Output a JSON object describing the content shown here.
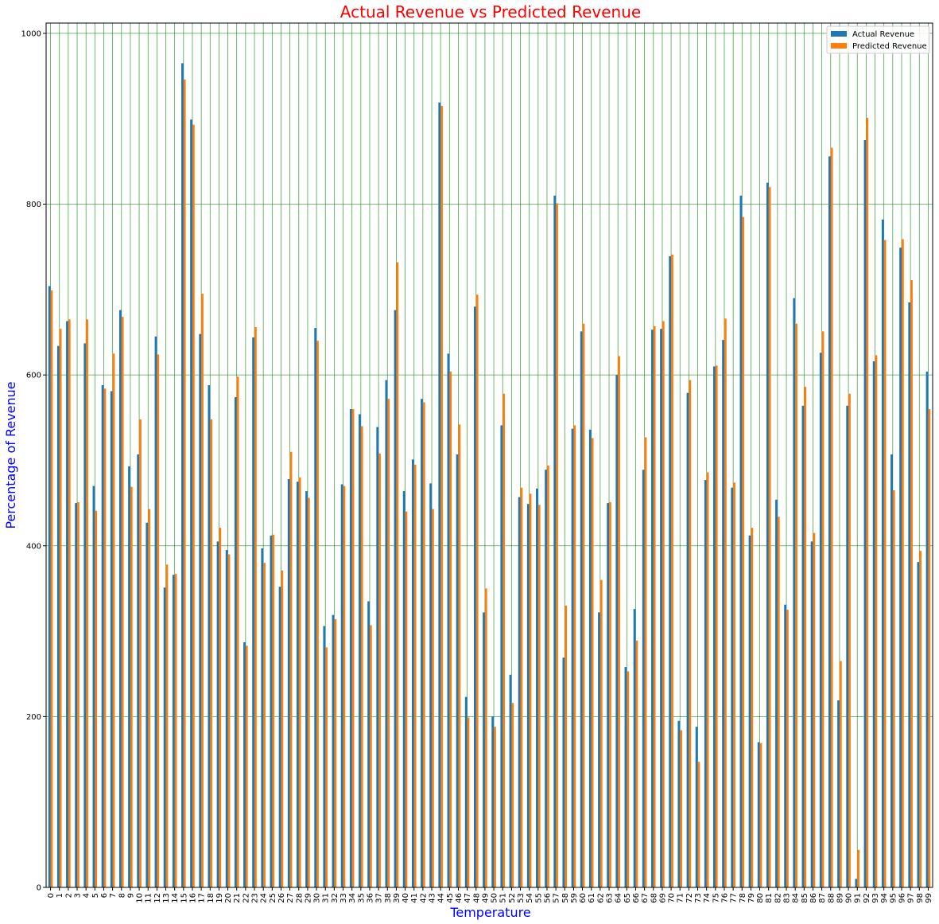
{
  "chart_data": {
    "type": "bar",
    "title": "Actual Revenue vs Predicted Revenue",
    "xlabel": "Temperature",
    "ylabel": "Percentage of Revenue",
    "ylim": [
      0,
      1012
    ],
    "yticks": [
      0,
      200,
      400,
      600,
      800,
      1000
    ],
    "grid": true,
    "legend_position": "top-right",
    "colors": {
      "title": "#ff0000",
      "axis_labels": "#0000ff",
      "grid": "#008000",
      "actual": "#1f77b4",
      "predicted": "#ff7f0e"
    },
    "categories": [
      "0",
      "1",
      "2",
      "3",
      "4",
      "5",
      "6",
      "7",
      "8",
      "9",
      "10",
      "11",
      "12",
      "13",
      "14",
      "15",
      "16",
      "17",
      "18",
      "19",
      "20",
      "21",
      "22",
      "23",
      "24",
      "25",
      "26",
      "27",
      "28",
      "29",
      "30",
      "31",
      "32",
      "33",
      "34",
      "35",
      "36",
      "37",
      "38",
      "39",
      "40",
      "41",
      "42",
      "43",
      "44",
      "45",
      "46",
      "47",
      "48",
      "49",
      "50",
      "51",
      "52",
      "53",
      "54",
      "55",
      "56",
      "57",
      "58",
      "59",
      "60",
      "61",
      "62",
      "63",
      "64",
      "65",
      "66",
      "67",
      "68",
      "69",
      "70",
      "71",
      "72",
      "73",
      "74",
      "75",
      "76",
      "77",
      "78",
      "79",
      "80",
      "81",
      "82",
      "83",
      "84",
      "85",
      "86",
      "87",
      "88",
      "89",
      "90",
      "91",
      "92",
      "93",
      "94",
      "95",
      "96",
      "97",
      "98",
      "99"
    ],
    "series": [
      {
        "name": "Actual Revenue",
        "values": [
          704,
          634,
          663,
          450,
          637,
          470,
          588,
          581,
          676,
          493,
          507,
          427,
          645,
          351,
          366,
          965,
          899,
          648,
          588,
          405,
          395,
          574,
          287,
          644,
          397,
          412,
          352,
          478,
          475,
          464,
          655,
          306,
          319,
          472,
          560,
          554,
          335,
          539,
          594,
          676,
          464,
          501,
          572,
          473,
          919,
          625,
          507,
          223,
          680,
          322,
          200,
          541,
          249,
          457,
          449,
          467,
          489,
          810,
          269,
          537,
          651,
          536,
          322,
          450,
          600,
          258,
          326,
          489,
          653,
          654,
          739,
          195,
          579,
          188,
          477,
          610,
          641,
          468,
          810,
          412,
          170,
          825,
          454,
          331,
          690,
          564,
          405,
          626,
          856,
          219,
          564,
          10,
          875,
          616,
          782,
          507,
          749,
          685,
          381,
          604
        ],
        "color": "#1f77b4"
      },
      {
        "name": "Predicted Revenue",
        "values": [
          699,
          654,
          665,
          451,
          665,
          441,
          584,
          625,
          668,
          469,
          548,
          443,
          624,
          378,
          367,
          946,
          893,
          695,
          548,
          421,
          390,
          598,
          283,
          656,
          380,
          413,
          371,
          510,
          480,
          456,
          640,
          281,
          314,
          470,
          560,
          540,
          307,
          508,
          572,
          732,
          440,
          495,
          568,
          443,
          915,
          604,
          542,
          199,
          694,
          350,
          188,
          578,
          216,
          468,
          461,
          448,
          494,
          801,
          330,
          541,
          660,
          526,
          360,
          451,
          622,
          253,
          289,
          527,
          657,
          663,
          741,
          184,
          594,
          147,
          486,
          611,
          666,
          474,
          785,
          421,
          169,
          820,
          434,
          325,
          660,
          586,
          415,
          651,
          866,
          265,
          578,
          44,
          901,
          623,
          758,
          465,
          759,
          711,
          394,
          560
        ],
        "color": "#ff7f0e"
      }
    ]
  }
}
